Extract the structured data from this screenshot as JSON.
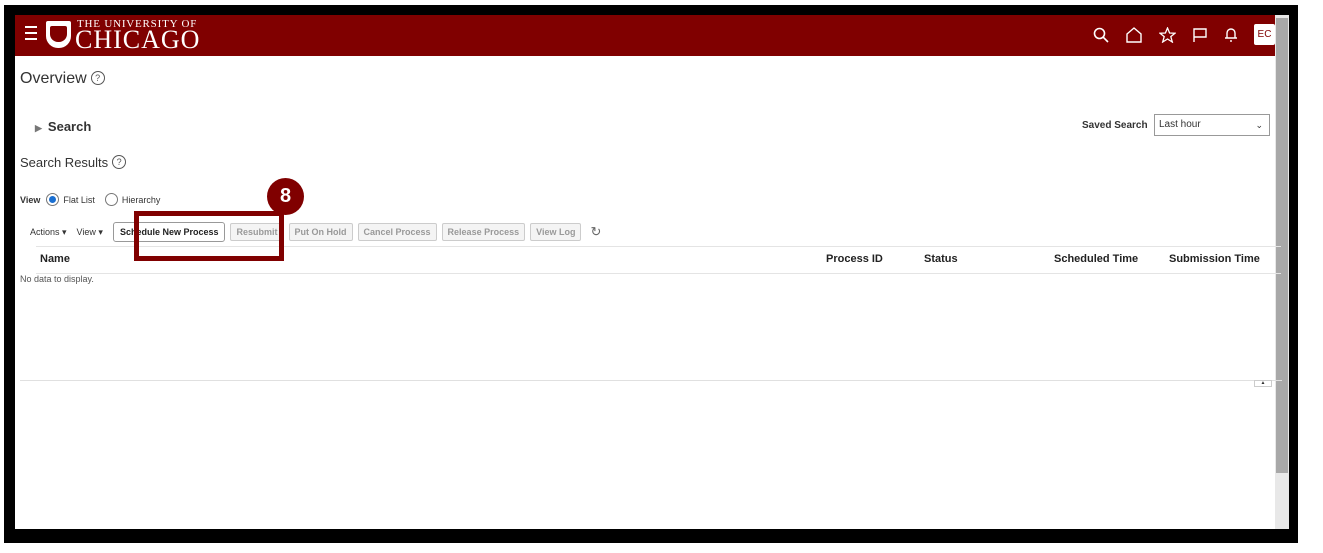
{
  "header": {
    "logo_top": "THE UNIVERSITY OF",
    "logo_main": "CHICAGO",
    "avatar": "EC",
    "icons": [
      "search-icon",
      "home-icon",
      "star-icon",
      "flag-icon",
      "bell-icon"
    ]
  },
  "page": {
    "title": "Overview",
    "search_label": "Search",
    "saved_search_label": "Saved Search",
    "saved_search_value": "Last hour",
    "results_title": "Search Results"
  },
  "view": {
    "label": "View",
    "options": [
      {
        "label": "Flat List",
        "selected": true
      },
      {
        "label": "Hierarchy",
        "selected": false
      }
    ]
  },
  "toolbar": {
    "actions": "Actions",
    "view": "View",
    "schedule": "Schedule New Process",
    "resubmit": "Resubmit",
    "hold": "Put On Hold",
    "cancel": "Cancel Process",
    "release": "Release Process",
    "log": "View Log"
  },
  "table": {
    "columns": [
      "Name",
      "Process ID",
      "Status",
      "Scheduled Time",
      "Submission Time"
    ],
    "empty_text": "No data to display."
  },
  "annotation": {
    "step": "8",
    "color": "#800000"
  }
}
